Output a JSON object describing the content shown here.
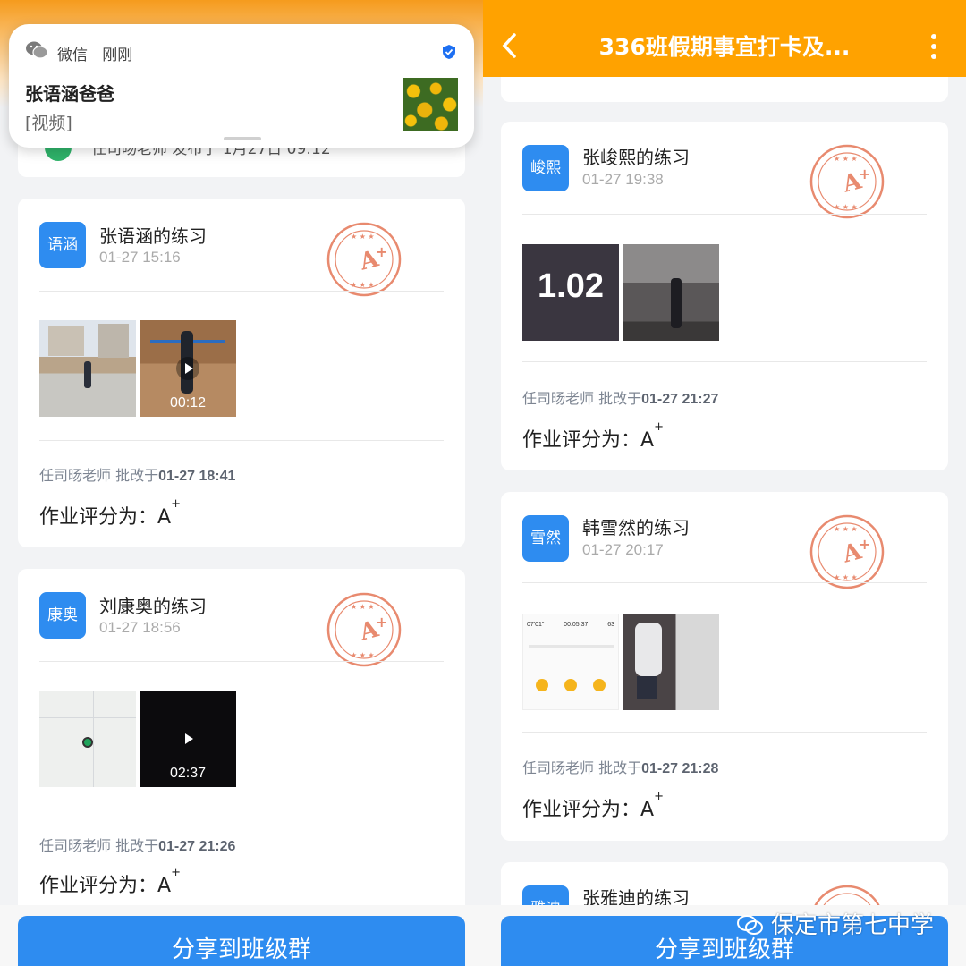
{
  "notification": {
    "app": "微信",
    "time": "刚刚",
    "title": "张语涵爸爸",
    "body": "[视频]"
  },
  "left_partial_text": "任司旸老师 发布于 1月27日 09:12",
  "header": {
    "title": "336班假期事宜打卡及..."
  },
  "cards": [
    {
      "avatar": "语涵",
      "name": "张语涵的练习",
      "time": "01-27 15:16",
      "teacher": "任司旸老师 批改于",
      "review_time": "01-27 18:41",
      "grade_label": "作业评分为：",
      "grade": "A",
      "grade_sup": "+",
      "video_duration": "00:12"
    },
    {
      "avatar": "康奥",
      "name": "刘康奥的练习",
      "time": "01-27 18:56",
      "teacher": "任司旸老师 批改于",
      "review_time": "01-27 21:26",
      "grade_label": "作业评分为：",
      "grade": "A",
      "grade_sup": "+",
      "video_duration": "02:37"
    },
    {
      "avatar": "峻熙",
      "name": "张峻熙的练习",
      "time": "01-27 19:38",
      "teacher": "任司旸老师 批改于",
      "review_time": "01-27 21:27",
      "grade_label": "作业评分为：",
      "grade": "A",
      "grade_sup": "+",
      "photo_text": "1.02"
    },
    {
      "avatar": "雪然",
      "name": "韩雪然的练习",
      "time": "01-27 20:17",
      "teacher": "任司旸老师 批改于",
      "review_time": "01-27 21:28",
      "grade_label": "作业评分为：",
      "grade": "A",
      "grade_sup": "+",
      "screen_stats": [
        "07'01\"",
        "00:05:37",
        "63"
      ]
    },
    {
      "avatar": "雅迪",
      "name": "张雅迪的练习"
    }
  ],
  "share_button": "分享到班级群",
  "watermark": "保定市第七中学",
  "colors": {
    "header": "#ffa200",
    "accent_blue": "#2e8cf0",
    "stamp_red": "#e88a6f"
  }
}
